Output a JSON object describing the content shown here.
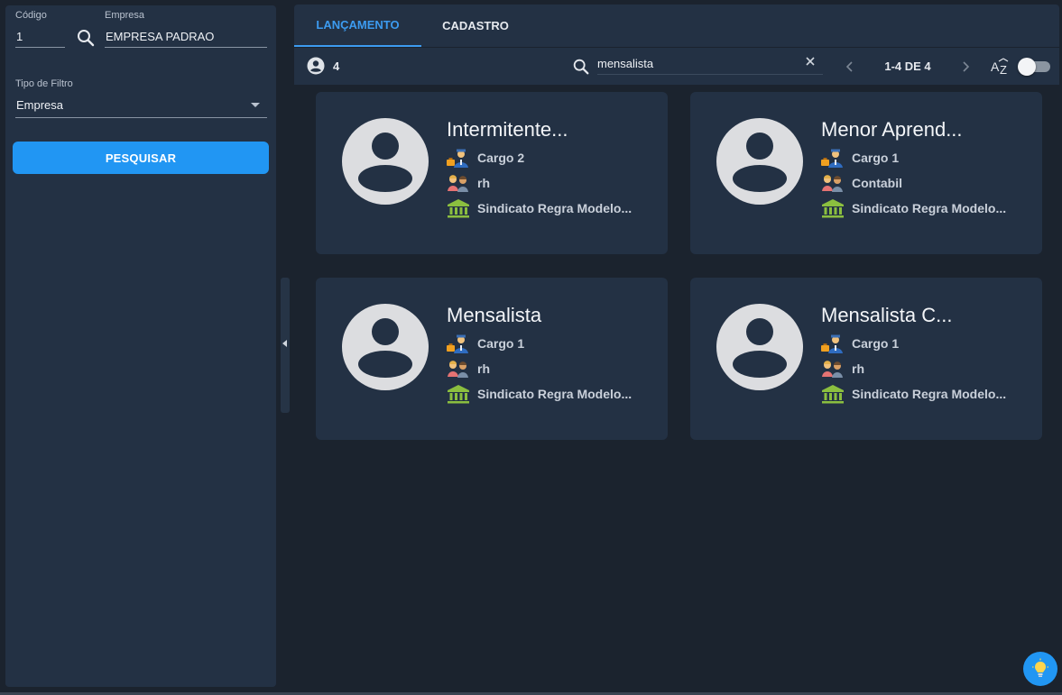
{
  "filters": {
    "codigo_label": "Código",
    "codigo_value": "1",
    "empresa_label": "Empresa",
    "empresa_value": "EMPRESA PADRAO",
    "tipo_label": "Tipo de Filtro",
    "tipo_value": "Empresa",
    "search_button": "PESQUISAR"
  },
  "tabs": [
    {
      "label": "LANÇAMENTO",
      "active": true
    },
    {
      "label": "CADASTRO",
      "active": false
    }
  ],
  "toolbar": {
    "count": "4",
    "search_value": "mensalista",
    "pager_text": "1-4 DE 4",
    "sort_icon": "sort-alpha-icon"
  },
  "cards": [
    {
      "title": "Intermitente...",
      "cargo": "Cargo 2",
      "setor": "rh",
      "sindicato": "Sindicato Regra Modelo..."
    },
    {
      "title": "Menor Aprend...",
      "cargo": "Cargo 1",
      "setor": "Contabil",
      "sindicato": "Sindicato Regra Modelo..."
    },
    {
      "title": "Mensalista",
      "cargo": "Cargo 1",
      "setor": "rh",
      "sindicato": "Sindicato Regra Modelo..."
    },
    {
      "title": "Mensalista C...",
      "cargo": "Cargo 1",
      "setor": "rh",
      "sindicato": "Sindicato Regra Modelo..."
    }
  ],
  "colors": {
    "accent": "#2196f3",
    "panel": "#233144",
    "background": "#1b232e"
  }
}
